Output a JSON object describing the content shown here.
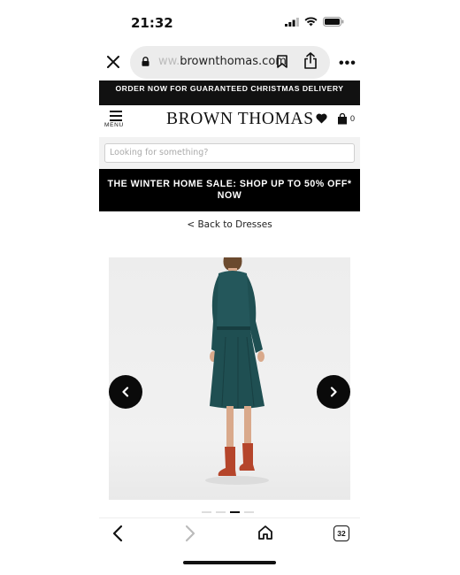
{
  "status_bar": {
    "time": "21:32"
  },
  "browser": {
    "url_faded": "ww.",
    "url_main": "brownthomas.com",
    "tab_count": "32"
  },
  "promo_top": "ORDER NOW FOR GUARANTEED CHRISTMAS DELIVERY",
  "header": {
    "menu_label": "MENU",
    "logo": "BROWN THOMAS",
    "bag_count": "0"
  },
  "search": {
    "placeholder": "Looking for something?"
  },
  "promo_sale": "THE WINTER HOME SALE: SHOP UP TO 50% OFF* NOW",
  "back_link": "< Back to Dresses",
  "carousel": {
    "slide_count": 4,
    "active_index": 2
  },
  "colors": {
    "dress": "#1f4f52",
    "boots": "#b5452b",
    "dark": "#111111"
  }
}
